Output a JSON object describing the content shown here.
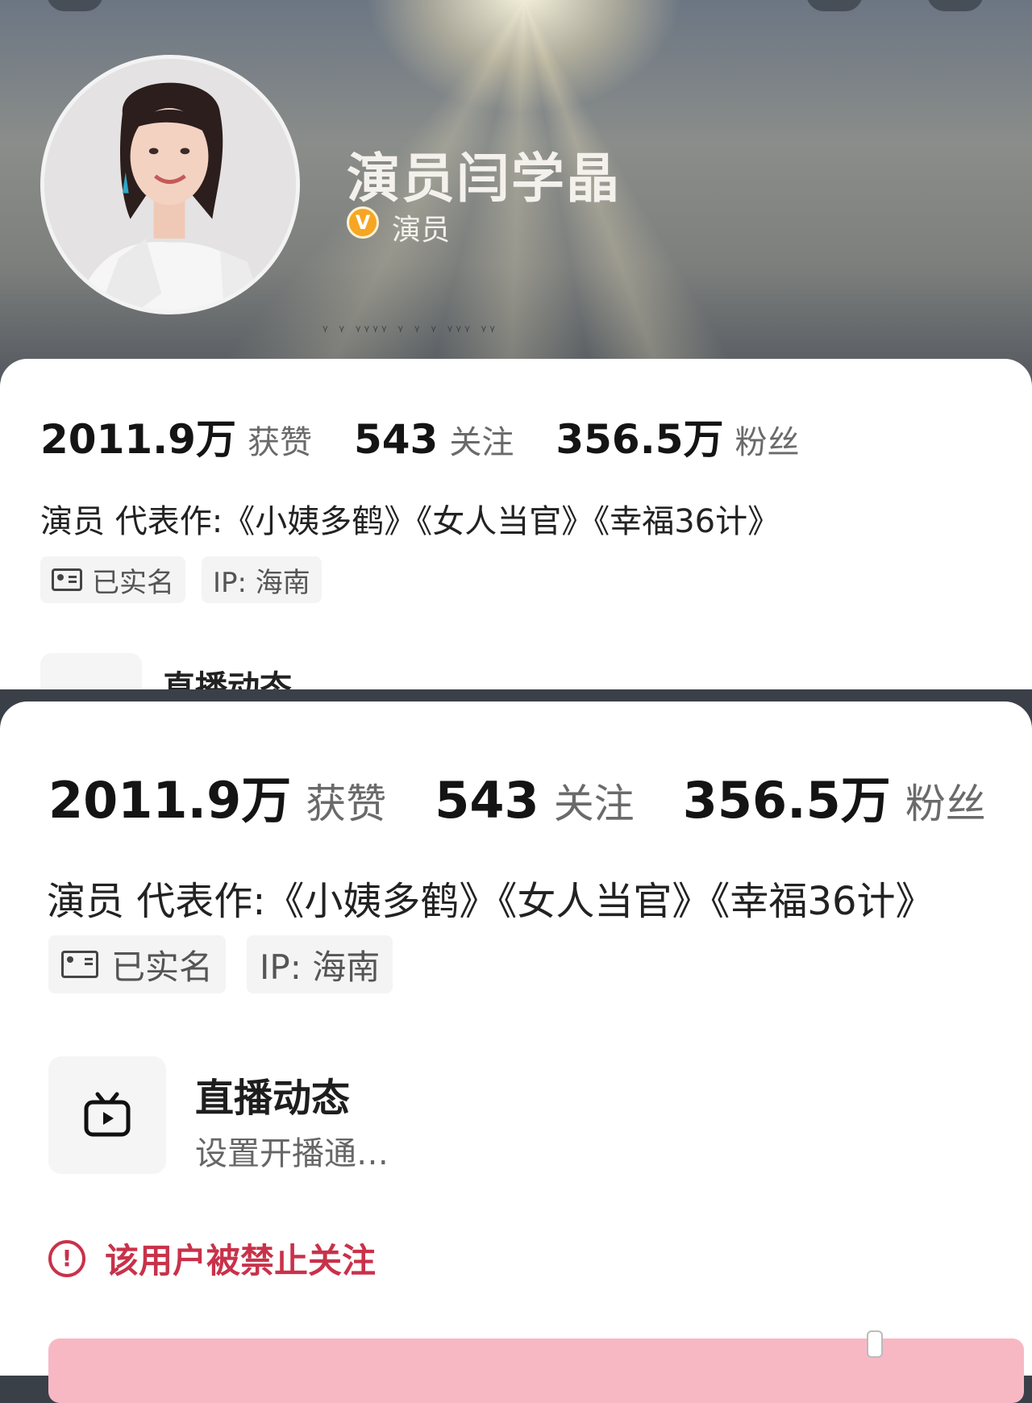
{
  "profile": {
    "name": "演员闫学晶",
    "verified_badge": "V",
    "verified_role": "演员"
  },
  "stats": {
    "likes_value": "2011.9万",
    "likes_label": "获赞",
    "following_value": "543",
    "following_label": "关注",
    "followers_value": "356.5万",
    "followers_label": "粉丝"
  },
  "bio": "演员 代表作:《小姨多鹤》《女人当官》《幸福36计》",
  "tags": {
    "real_name": "已实名",
    "ip": "IP: 海南"
  },
  "live": {
    "title": "直播动态",
    "subtitle": "设置开播通…"
  },
  "warning": {
    "icon": "!",
    "text": "该用户被禁止关注"
  },
  "colors": {
    "warning": "#c8324a",
    "follow_button": "#f7b8c4",
    "verified_badge": "#f6a623"
  },
  "icons": {
    "verified": "verified-v-icon",
    "id_card": "id-card-icon",
    "live": "tv-play-icon",
    "warning": "exclamation-circle-icon"
  }
}
